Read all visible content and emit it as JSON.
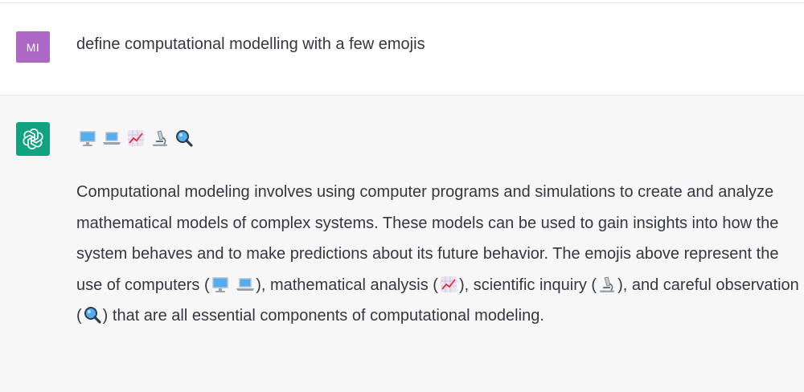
{
  "user": {
    "avatar_initials": "MI",
    "avatar_color": "#ab68c5",
    "message": "define computational modelling with a few emojis"
  },
  "assistant": {
    "avatar_icon": "openai-logo-icon",
    "avatar_color": "#11a37f",
    "emojis": [
      "desktop-computer-icon",
      "laptop-icon",
      "chart-increasing-icon",
      "microscope-icon",
      "magnifying-glass-icon"
    ],
    "answer": {
      "part1": "Computational modeling involves using computer programs and simulations to create and analyze mathematical models of complex systems. These models can be used to gain insights into how the system behaves and to make predictions about its future behavior. The emojis above represent the use of computers (",
      "part2": "), mathematical analysis (",
      "part3": "), scientific inquiry (",
      "part4": "), and careful observation (",
      "part5": ") that are all essential components of computational modeling."
    }
  }
}
